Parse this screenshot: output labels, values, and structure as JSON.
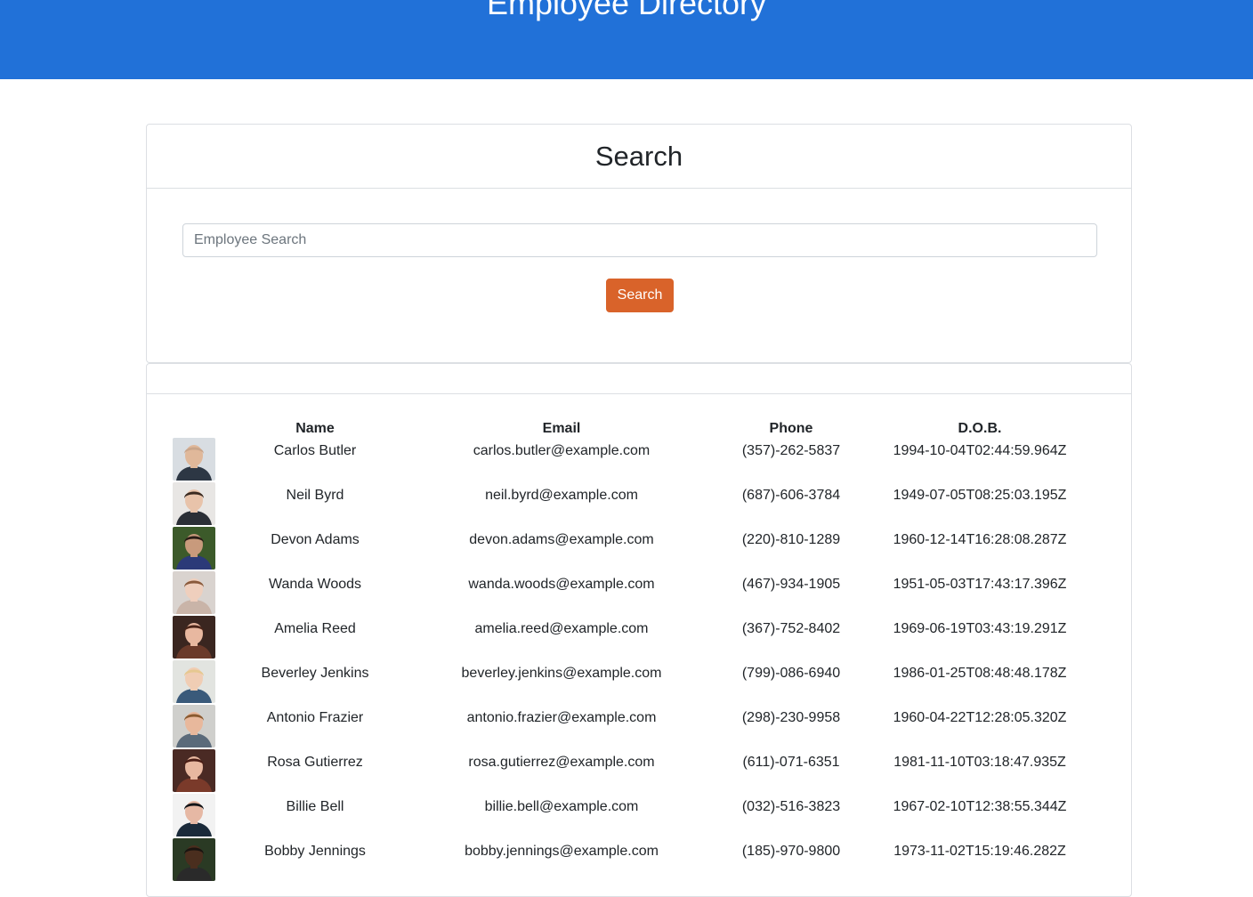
{
  "header": {
    "title": "Employee Directory"
  },
  "search_card": {
    "title": "Search",
    "input_placeholder": "Employee Search",
    "input_value": "",
    "button_label": "Search",
    "button_color": "#d9632a"
  },
  "colors": {
    "header_bg": "#2171d8"
  },
  "table": {
    "columns": [
      "",
      "Name",
      "Email",
      "Phone",
      "D.O.B."
    ],
    "rows": [
      {
        "name": "Carlos Butler",
        "email": "carlos.butler@example.com",
        "phone": "(357)-262-5837",
        "dob": "1994-10-04T02:44:59.964Z",
        "avatar": {
          "bg": "#d8dde2",
          "skin": "#e0b89a",
          "hair": "#c9a58a",
          "shirt": "#2d3744"
        }
      },
      {
        "name": "Neil Byrd",
        "email": "neil.byrd@example.com",
        "phone": "(687)-606-3784",
        "dob": "1949-07-05T08:25:03.195Z",
        "avatar": {
          "bg": "#e8e6e4",
          "skin": "#e8c3aa",
          "hair": "#3a2a20",
          "shirt": "#2b2f36"
        }
      },
      {
        "name": "Devon Adams",
        "email": "devon.adams@example.com",
        "phone": "(220)-810-1289",
        "dob": "1960-12-14T16:28:08.287Z",
        "avatar": {
          "bg": "#3c5a2a",
          "skin": "#c89a7c",
          "hair": "#2a1c16",
          "shirt": "#2b3a78"
        }
      },
      {
        "name": "Wanda Woods",
        "email": "wanda.woods@example.com",
        "phone": "(467)-934-1905",
        "dob": "1951-05-03T17:43:17.396Z",
        "avatar": {
          "bg": "#d9d3cf",
          "skin": "#efcfbd",
          "hair": "#8a5a3c",
          "shirt": "#c9b4a8"
        }
      },
      {
        "name": "Amelia Reed",
        "email": "amelia.reed@example.com",
        "phone": "(367)-752-8402",
        "dob": "1969-06-19T03:43:19.291Z",
        "avatar": {
          "bg": "#3a2620",
          "skin": "#e8b8a0",
          "hair": "#4a2418",
          "shirt": "#6a3a2a"
        }
      },
      {
        "name": "Beverley Jenkins",
        "email": "beverley.jenkins@example.com",
        "phone": "(799)-086-6940",
        "dob": "1986-01-25T08:48:48.178Z",
        "avatar": {
          "bg": "#e2e4e0",
          "skin": "#f0cdb4",
          "hair": "#e6c890",
          "shirt": "#3a5a7a"
        }
      },
      {
        "name": "Antonio Frazier",
        "email": "antonio.frazier@example.com",
        "phone": "(298)-230-9958",
        "dob": "1960-04-22T12:28:05.320Z",
        "avatar": {
          "bg": "#cfcfcc",
          "skin": "#e8b89c",
          "hair": "#8a5a30",
          "shirt": "#5a6a7a"
        }
      },
      {
        "name": "Rosa Gutierrez",
        "email": "rosa.gutierrez@example.com",
        "phone": "(611)-071-6351",
        "dob": "1981-11-10T03:18:47.935Z",
        "avatar": {
          "bg": "#4a2a24",
          "skin": "#e8b8a0",
          "hair": "#4a1c14",
          "shirt": "#7a3a2a"
        }
      },
      {
        "name": "Billie Bell",
        "email": "billie.bell@example.com",
        "phone": "(032)-516-3823",
        "dob": "1967-02-10T12:38:55.344Z",
        "avatar": {
          "bg": "#f2f2f2",
          "skin": "#e6b8a4",
          "hair": "#121418",
          "shirt": "#1a2a3a"
        }
      },
      {
        "name": "Bobby Jennings",
        "email": "bobby.jennings@example.com",
        "phone": "(185)-970-9800",
        "dob": "1973-11-02T15:19:46.282Z",
        "avatar": {
          "bg": "#2a3a24",
          "skin": "#4a2e1e",
          "hair": "#1a1410",
          "shirt": "#2a2a2a"
        }
      }
    ]
  }
}
